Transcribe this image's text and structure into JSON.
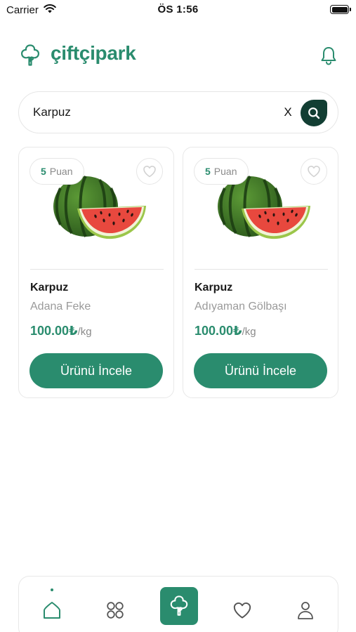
{
  "status_bar": {
    "carrier": "Carrier",
    "time": "ÖS 1:56"
  },
  "header": {
    "brand": "çiftçipark",
    "logo_icon": "tree-icon",
    "notification_icon": "bell-icon"
  },
  "search": {
    "value": "Karpuz",
    "placeholder": "",
    "clear_label": "X",
    "search_icon": "search-icon"
  },
  "products": [
    {
      "points_value": "5",
      "points_label": "Puan",
      "name": "Karpuz",
      "origin": "Adana Feke",
      "price": "100.00₺",
      "unit": "/kg",
      "button_label": "Ürünü İncele",
      "favorite_icon": "heart-outline-icon",
      "image": "watermelon"
    },
    {
      "points_value": "5",
      "points_label": "Puan",
      "name": "Karpuz",
      "origin": "Adıyaman Gölbaşı",
      "price": "100.00₺",
      "unit": "/kg",
      "button_label": "Ürünü İncele",
      "favorite_icon": "heart-outline-icon",
      "image": "watermelon"
    }
  ],
  "bottom_nav": {
    "items": [
      {
        "icon": "home-icon",
        "active": true
      },
      {
        "icon": "categories-icon",
        "active": false
      },
      {
        "icon": "tree-icon",
        "active": false,
        "featured": true
      },
      {
        "icon": "heart-icon",
        "active": false
      },
      {
        "icon": "profile-icon",
        "active": false
      }
    ]
  },
  "colors": {
    "brand": "#2a8c6e",
    "search_button": "#123e33",
    "muted_text": "#9a9a9a"
  }
}
